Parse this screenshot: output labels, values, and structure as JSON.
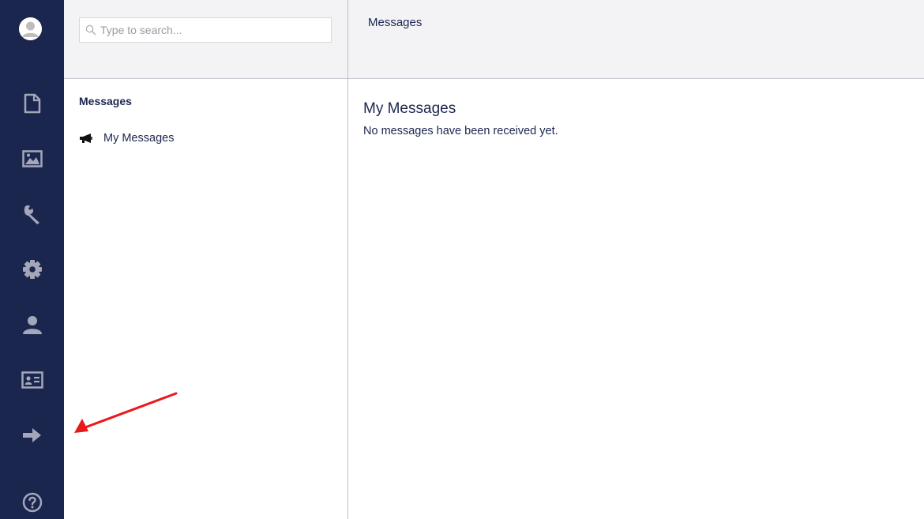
{
  "sidebar": {
    "icons": [
      {
        "name": "avatar-icon"
      },
      {
        "name": "content-icon"
      },
      {
        "name": "media-icon"
      },
      {
        "name": "wrench-icon"
      },
      {
        "name": "gear-icon"
      },
      {
        "name": "user-icon"
      },
      {
        "name": "id-card-icon"
      },
      {
        "name": "arrow-right-icon"
      },
      {
        "name": "help-icon"
      }
    ],
    "background": "#1b264f",
    "icon_color": "#a3a7b9"
  },
  "search": {
    "placeholder": "Type to search..."
  },
  "tree": {
    "title": "Messages",
    "items": [
      {
        "label": "My Messages",
        "icon": "megaphone-icon"
      }
    ]
  },
  "content": {
    "header_title": "Messages",
    "section_title": "My Messages",
    "empty_text": "No messages have been received yet."
  },
  "annotation": {
    "color": "#e8191c"
  }
}
